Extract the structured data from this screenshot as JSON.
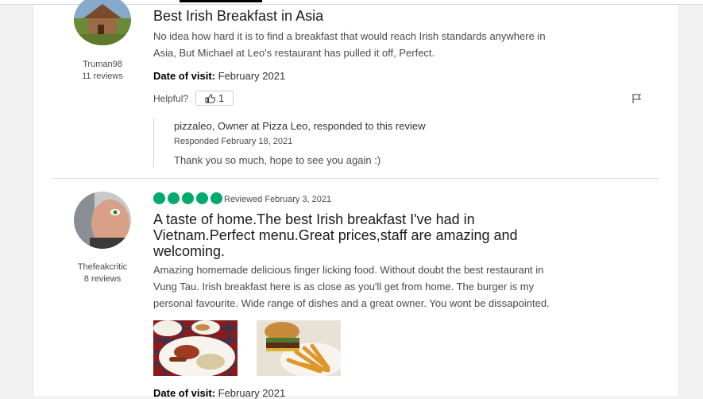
{
  "reviews": [
    {
      "user": {
        "name": "Truman98",
        "review_count": "11 reviews"
      },
      "title": "Best Irish Breakfast in Asia",
      "body": [
        "No idea how hard it is to find a breakfast that would reach Irish standards anywhere in",
        "Asia, But Michael at Leo's restaurant has pulled it off, Perfect."
      ],
      "date_label": "Date of visit:",
      "date_value": "February 2021",
      "helpful_label": "Helpful?",
      "helpful_count": "1",
      "response": {
        "who": "pizzaleo, Owner at Pizza Leo, responded to this review",
        "date": "Responded February 18, 2021",
        "text": "Thank you so much, hope to see you again :)"
      }
    },
    {
      "user": {
        "name": "Thefeakcritic",
        "review_count": "8 reviews"
      },
      "rating": 5,
      "reviewed_date": "Reviewed February 3, 2021",
      "title": [
        "A taste of home.The best Irish breakfast I've had in",
        "Vietnam.Perfect menu.Great prices,staff are amazing and",
        "welcoming."
      ],
      "body": [
        "Amazing homemade delicious finger licking food. Without doubt the best restaurant in",
        "Vung Tau. Irish breakfast here is as close as you'll get from home. The burger is my",
        "personal favourite. Wide range of dishes and a great owner. You wont be dissapointed."
      ],
      "date_label": "Date of visit:",
      "date_value": "February 2021"
    }
  ],
  "colors": {
    "rating_bubble": "#00aa6c",
    "text_secondary": "#4a4a4a"
  }
}
